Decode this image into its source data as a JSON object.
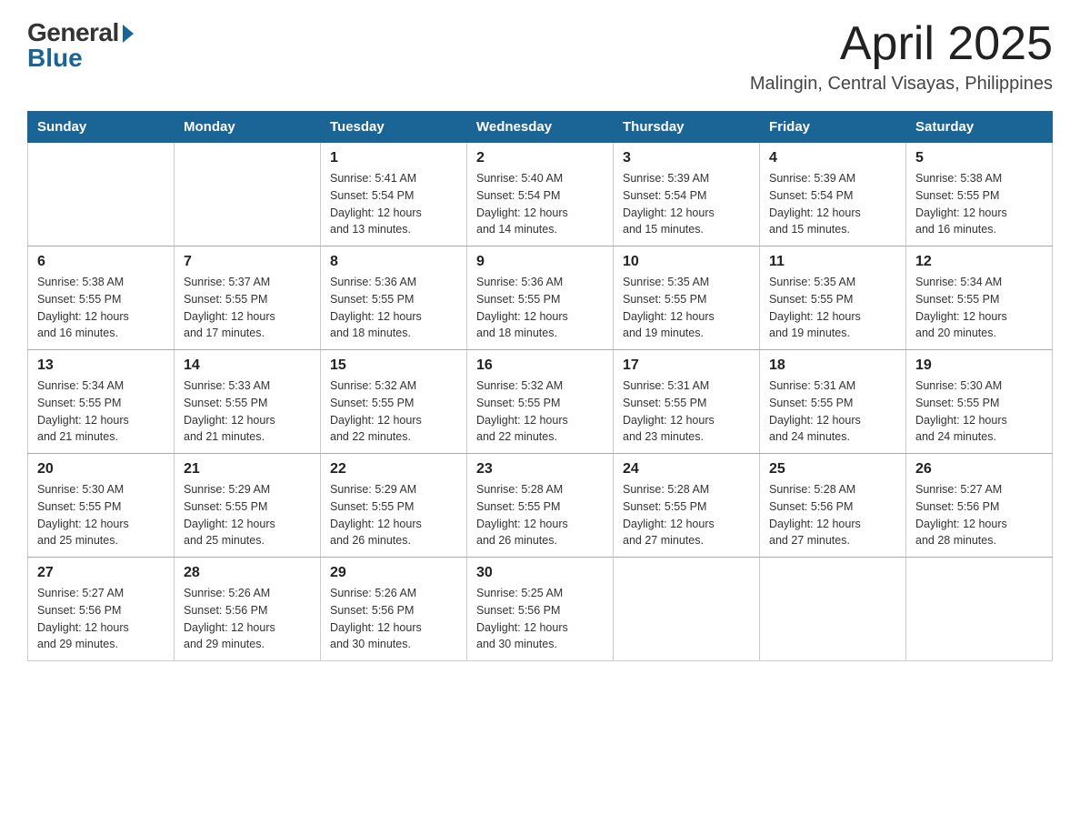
{
  "logo": {
    "general": "General",
    "blue": "Blue"
  },
  "header": {
    "title": "April 2025",
    "subtitle": "Malingin, Central Visayas, Philippines"
  },
  "days_of_week": [
    "Sunday",
    "Monday",
    "Tuesday",
    "Wednesday",
    "Thursday",
    "Friday",
    "Saturday"
  ],
  "weeks": [
    [
      {
        "day": "",
        "info": ""
      },
      {
        "day": "",
        "info": ""
      },
      {
        "day": "1",
        "info": "Sunrise: 5:41 AM\nSunset: 5:54 PM\nDaylight: 12 hours\nand 13 minutes."
      },
      {
        "day": "2",
        "info": "Sunrise: 5:40 AM\nSunset: 5:54 PM\nDaylight: 12 hours\nand 14 minutes."
      },
      {
        "day": "3",
        "info": "Sunrise: 5:39 AM\nSunset: 5:54 PM\nDaylight: 12 hours\nand 15 minutes."
      },
      {
        "day": "4",
        "info": "Sunrise: 5:39 AM\nSunset: 5:54 PM\nDaylight: 12 hours\nand 15 minutes."
      },
      {
        "day": "5",
        "info": "Sunrise: 5:38 AM\nSunset: 5:55 PM\nDaylight: 12 hours\nand 16 minutes."
      }
    ],
    [
      {
        "day": "6",
        "info": "Sunrise: 5:38 AM\nSunset: 5:55 PM\nDaylight: 12 hours\nand 16 minutes."
      },
      {
        "day": "7",
        "info": "Sunrise: 5:37 AM\nSunset: 5:55 PM\nDaylight: 12 hours\nand 17 minutes."
      },
      {
        "day": "8",
        "info": "Sunrise: 5:36 AM\nSunset: 5:55 PM\nDaylight: 12 hours\nand 18 minutes."
      },
      {
        "day": "9",
        "info": "Sunrise: 5:36 AM\nSunset: 5:55 PM\nDaylight: 12 hours\nand 18 minutes."
      },
      {
        "day": "10",
        "info": "Sunrise: 5:35 AM\nSunset: 5:55 PM\nDaylight: 12 hours\nand 19 minutes."
      },
      {
        "day": "11",
        "info": "Sunrise: 5:35 AM\nSunset: 5:55 PM\nDaylight: 12 hours\nand 19 minutes."
      },
      {
        "day": "12",
        "info": "Sunrise: 5:34 AM\nSunset: 5:55 PM\nDaylight: 12 hours\nand 20 minutes."
      }
    ],
    [
      {
        "day": "13",
        "info": "Sunrise: 5:34 AM\nSunset: 5:55 PM\nDaylight: 12 hours\nand 21 minutes."
      },
      {
        "day": "14",
        "info": "Sunrise: 5:33 AM\nSunset: 5:55 PM\nDaylight: 12 hours\nand 21 minutes."
      },
      {
        "day": "15",
        "info": "Sunrise: 5:32 AM\nSunset: 5:55 PM\nDaylight: 12 hours\nand 22 minutes."
      },
      {
        "day": "16",
        "info": "Sunrise: 5:32 AM\nSunset: 5:55 PM\nDaylight: 12 hours\nand 22 minutes."
      },
      {
        "day": "17",
        "info": "Sunrise: 5:31 AM\nSunset: 5:55 PM\nDaylight: 12 hours\nand 23 minutes."
      },
      {
        "day": "18",
        "info": "Sunrise: 5:31 AM\nSunset: 5:55 PM\nDaylight: 12 hours\nand 24 minutes."
      },
      {
        "day": "19",
        "info": "Sunrise: 5:30 AM\nSunset: 5:55 PM\nDaylight: 12 hours\nand 24 minutes."
      }
    ],
    [
      {
        "day": "20",
        "info": "Sunrise: 5:30 AM\nSunset: 5:55 PM\nDaylight: 12 hours\nand 25 minutes."
      },
      {
        "day": "21",
        "info": "Sunrise: 5:29 AM\nSunset: 5:55 PM\nDaylight: 12 hours\nand 25 minutes."
      },
      {
        "day": "22",
        "info": "Sunrise: 5:29 AM\nSunset: 5:55 PM\nDaylight: 12 hours\nand 26 minutes."
      },
      {
        "day": "23",
        "info": "Sunrise: 5:28 AM\nSunset: 5:55 PM\nDaylight: 12 hours\nand 26 minutes."
      },
      {
        "day": "24",
        "info": "Sunrise: 5:28 AM\nSunset: 5:55 PM\nDaylight: 12 hours\nand 27 minutes."
      },
      {
        "day": "25",
        "info": "Sunrise: 5:28 AM\nSunset: 5:56 PM\nDaylight: 12 hours\nand 27 minutes."
      },
      {
        "day": "26",
        "info": "Sunrise: 5:27 AM\nSunset: 5:56 PM\nDaylight: 12 hours\nand 28 minutes."
      }
    ],
    [
      {
        "day": "27",
        "info": "Sunrise: 5:27 AM\nSunset: 5:56 PM\nDaylight: 12 hours\nand 29 minutes."
      },
      {
        "day": "28",
        "info": "Sunrise: 5:26 AM\nSunset: 5:56 PM\nDaylight: 12 hours\nand 29 minutes."
      },
      {
        "day": "29",
        "info": "Sunrise: 5:26 AM\nSunset: 5:56 PM\nDaylight: 12 hours\nand 30 minutes."
      },
      {
        "day": "30",
        "info": "Sunrise: 5:25 AM\nSunset: 5:56 PM\nDaylight: 12 hours\nand 30 minutes."
      },
      {
        "day": "",
        "info": ""
      },
      {
        "day": "",
        "info": ""
      },
      {
        "day": "",
        "info": ""
      }
    ]
  ]
}
